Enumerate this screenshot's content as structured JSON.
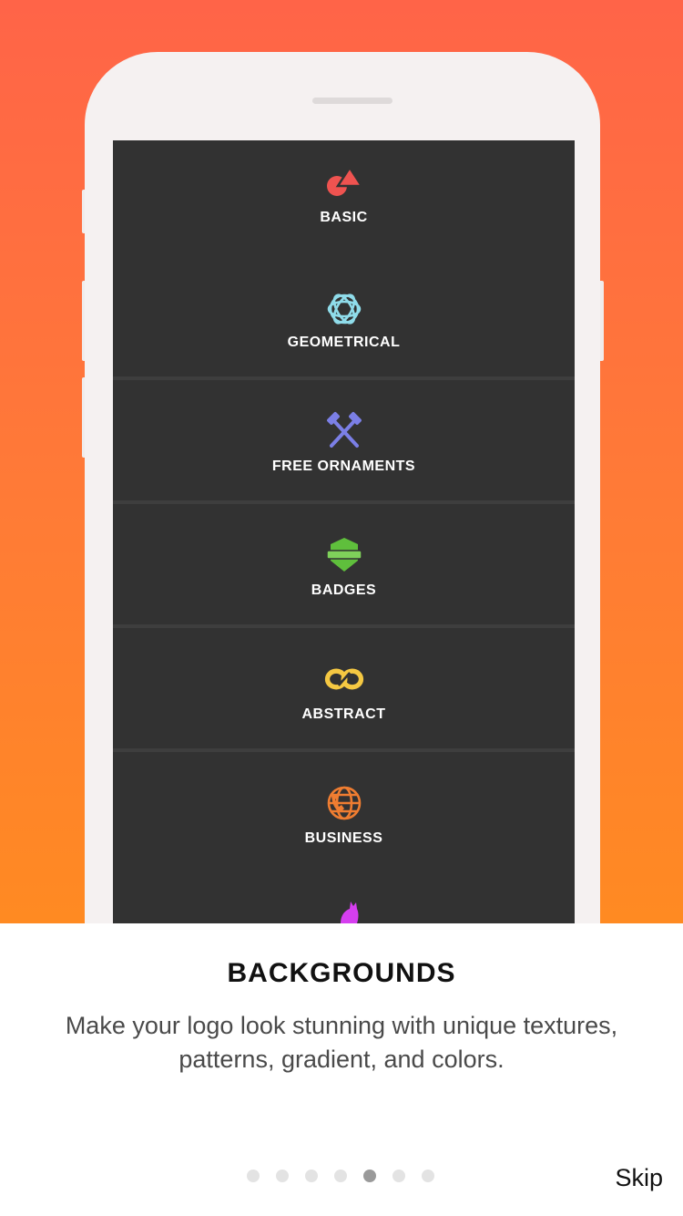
{
  "categories": [
    {
      "label": "BASIC",
      "icon": "shapes-icon",
      "color": "#ef5350"
    },
    {
      "label": "GEOMETRICAL",
      "icon": "geometric-flower-icon",
      "color": "#8fdcea"
    },
    {
      "label": "FREE ORNAMENTS",
      "icon": "crossed-hammers-icon",
      "color": "#7b7fe6"
    },
    {
      "label": "BADGES",
      "icon": "shield-badge-icon",
      "color": "#5fbf3c"
    },
    {
      "label": "ABSTRACT",
      "icon": "infinity-icon",
      "color": "#f5c842"
    },
    {
      "label": "BUSINESS",
      "icon": "globe-phone-icon",
      "color": "#ef7d31"
    },
    {
      "label": "",
      "icon": "cat-icon",
      "color": "#d63ef0"
    }
  ],
  "onboarding": {
    "title": "BACKGROUNDS",
    "description": "Make your logo look stunning with unique textures, patterns, gradient, and colors.",
    "page_count": 7,
    "active_page": 5,
    "skip_label": "Skip"
  },
  "colors": {
    "hero_gradient_top": "#ff6448",
    "hero_gradient_bottom": "#ff8a22",
    "phone_body": "#f5f1f1",
    "screen_tile": "#323232"
  }
}
